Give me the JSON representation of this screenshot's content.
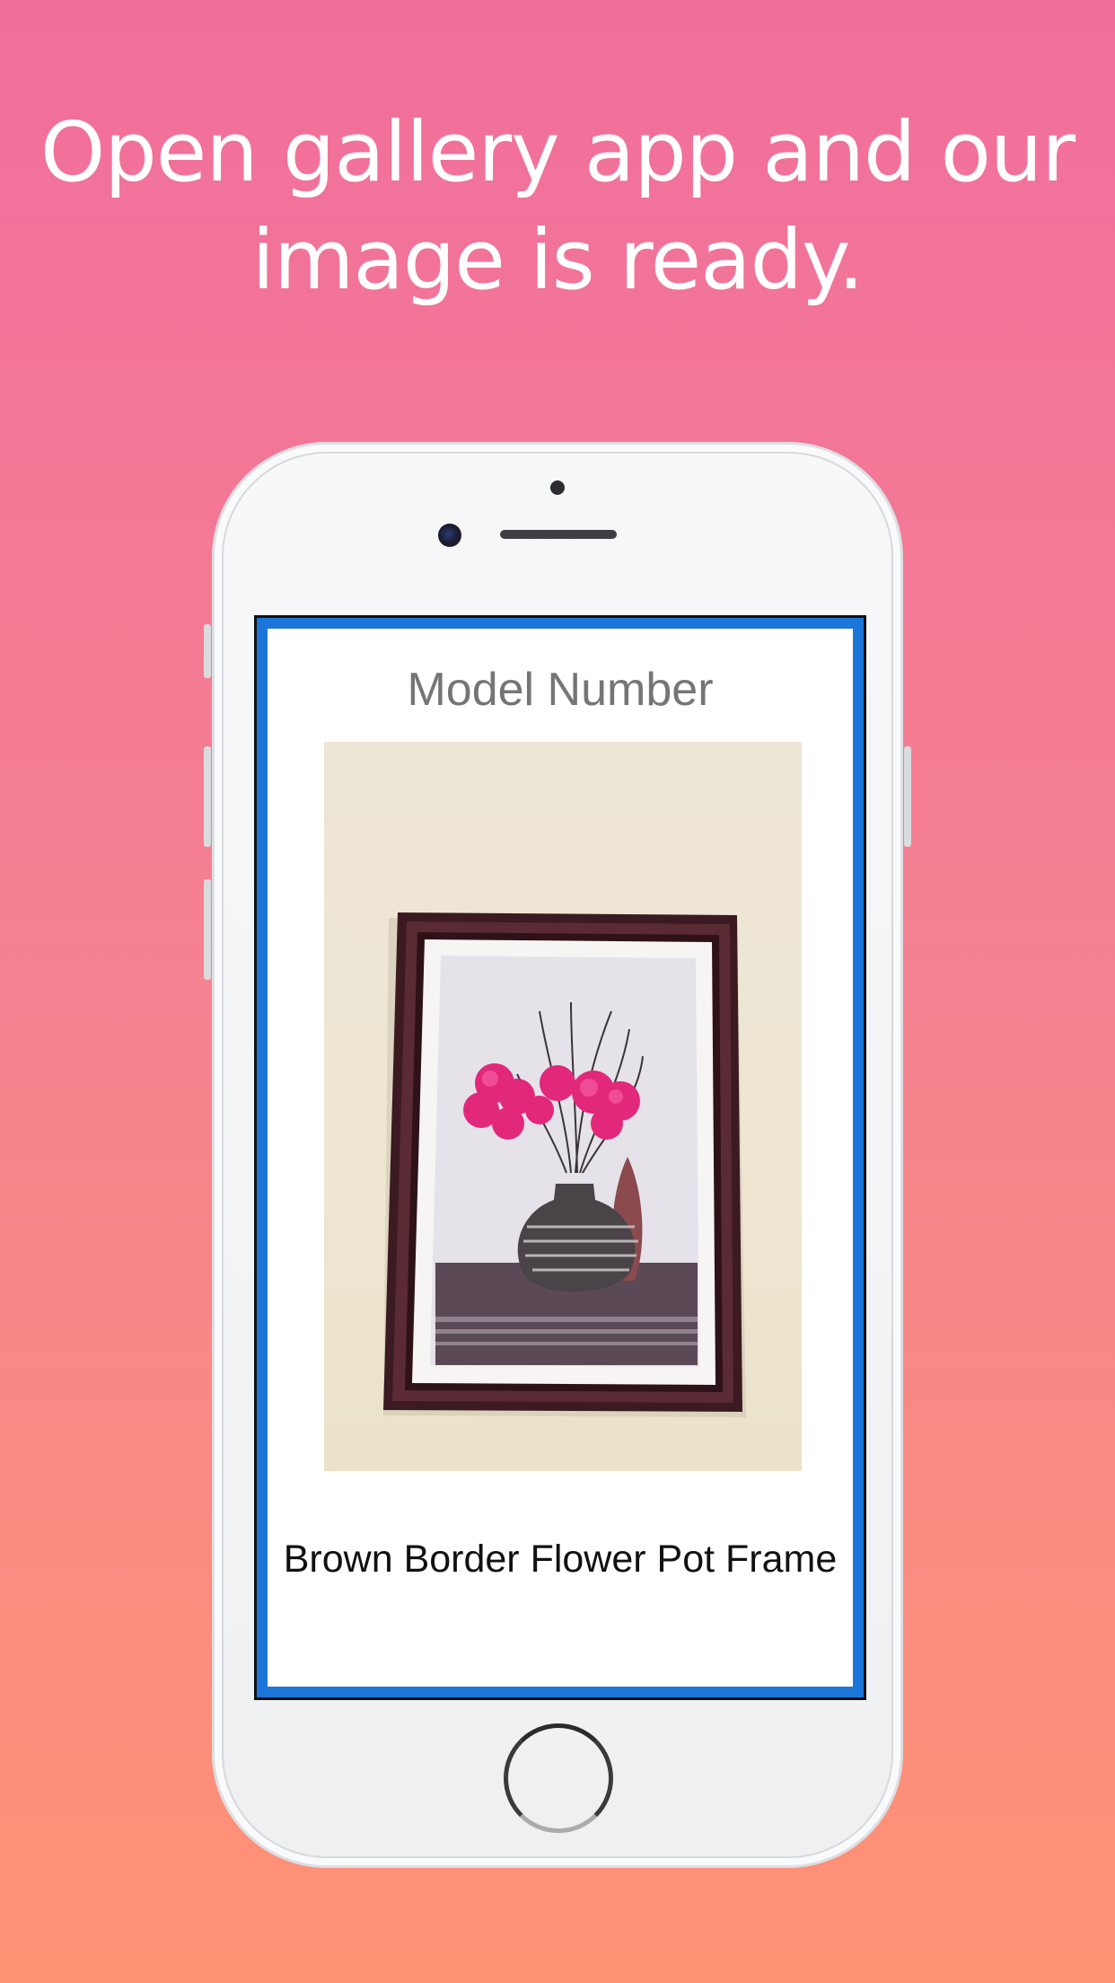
{
  "headline": {
    "line1": "Open gallery app and our",
    "line2": "image is ready."
  },
  "app": {
    "title": "Model Number",
    "caption": "Brown Border Flower Pot Frame"
  },
  "colors": {
    "gradient_top": "#f06e9c",
    "gradient_bottom": "#ff9274",
    "screen_border": "#1c75d8"
  },
  "icons": [
    "home-button-icon",
    "camera-icon",
    "speaker-icon"
  ]
}
